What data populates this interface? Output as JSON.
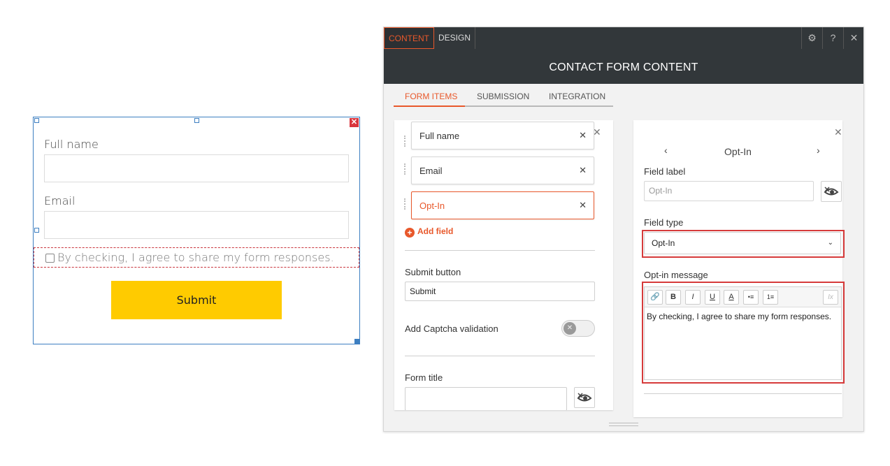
{
  "preview": {
    "close": "✕",
    "full_name_label": "Full name",
    "email_label": "Email",
    "optin_text": "By checking, I agree to share my form responses.",
    "submit_label": "Submit"
  },
  "panel": {
    "tabs": [
      {
        "label": "CONTENT"
      },
      {
        "label": "DESIGN"
      }
    ],
    "icons": {
      "settings": "⚙",
      "help": "?",
      "close": "✕"
    },
    "header_title": "CONTACT FORM CONTENT",
    "subtabs": [
      {
        "label": "FORM ITEMS"
      },
      {
        "label": "SUBMISSION"
      },
      {
        "label": "INTEGRATION"
      }
    ]
  },
  "form_items": {
    "close": "✕",
    "fields": [
      {
        "label": "Full name",
        "remove": "✕"
      },
      {
        "label": "Email",
        "remove": "✕"
      },
      {
        "label": "Opt-In",
        "remove": "✕"
      }
    ],
    "add_field": "Add field",
    "add_icon": "+",
    "submit_button_label": "Submit button",
    "submit_button_value": "Submit",
    "captcha_label": "Add Captcha validation",
    "captcha_toggle_icon": "✕",
    "form_title_label": "Form title",
    "form_title_value": ""
  },
  "field_settings": {
    "close": "✕",
    "prev": "‹",
    "next": "›",
    "title": "Opt-In",
    "field_label_label": "Field label",
    "field_label_placeholder": "Opt-In",
    "field_type_label": "Field type",
    "field_type_value": "Opt-In",
    "field_type_chevron": "⌄",
    "optin_message_label": "Opt-in message",
    "toolbar": {
      "link": "🔗",
      "bold": "B",
      "italic": "I",
      "underline": "U",
      "color": "A",
      "bullet_list": "•≡",
      "numbered_list": "1≡",
      "clear": "Ix"
    },
    "optin_message_value": "By checking, I agree to share my form responses."
  }
}
